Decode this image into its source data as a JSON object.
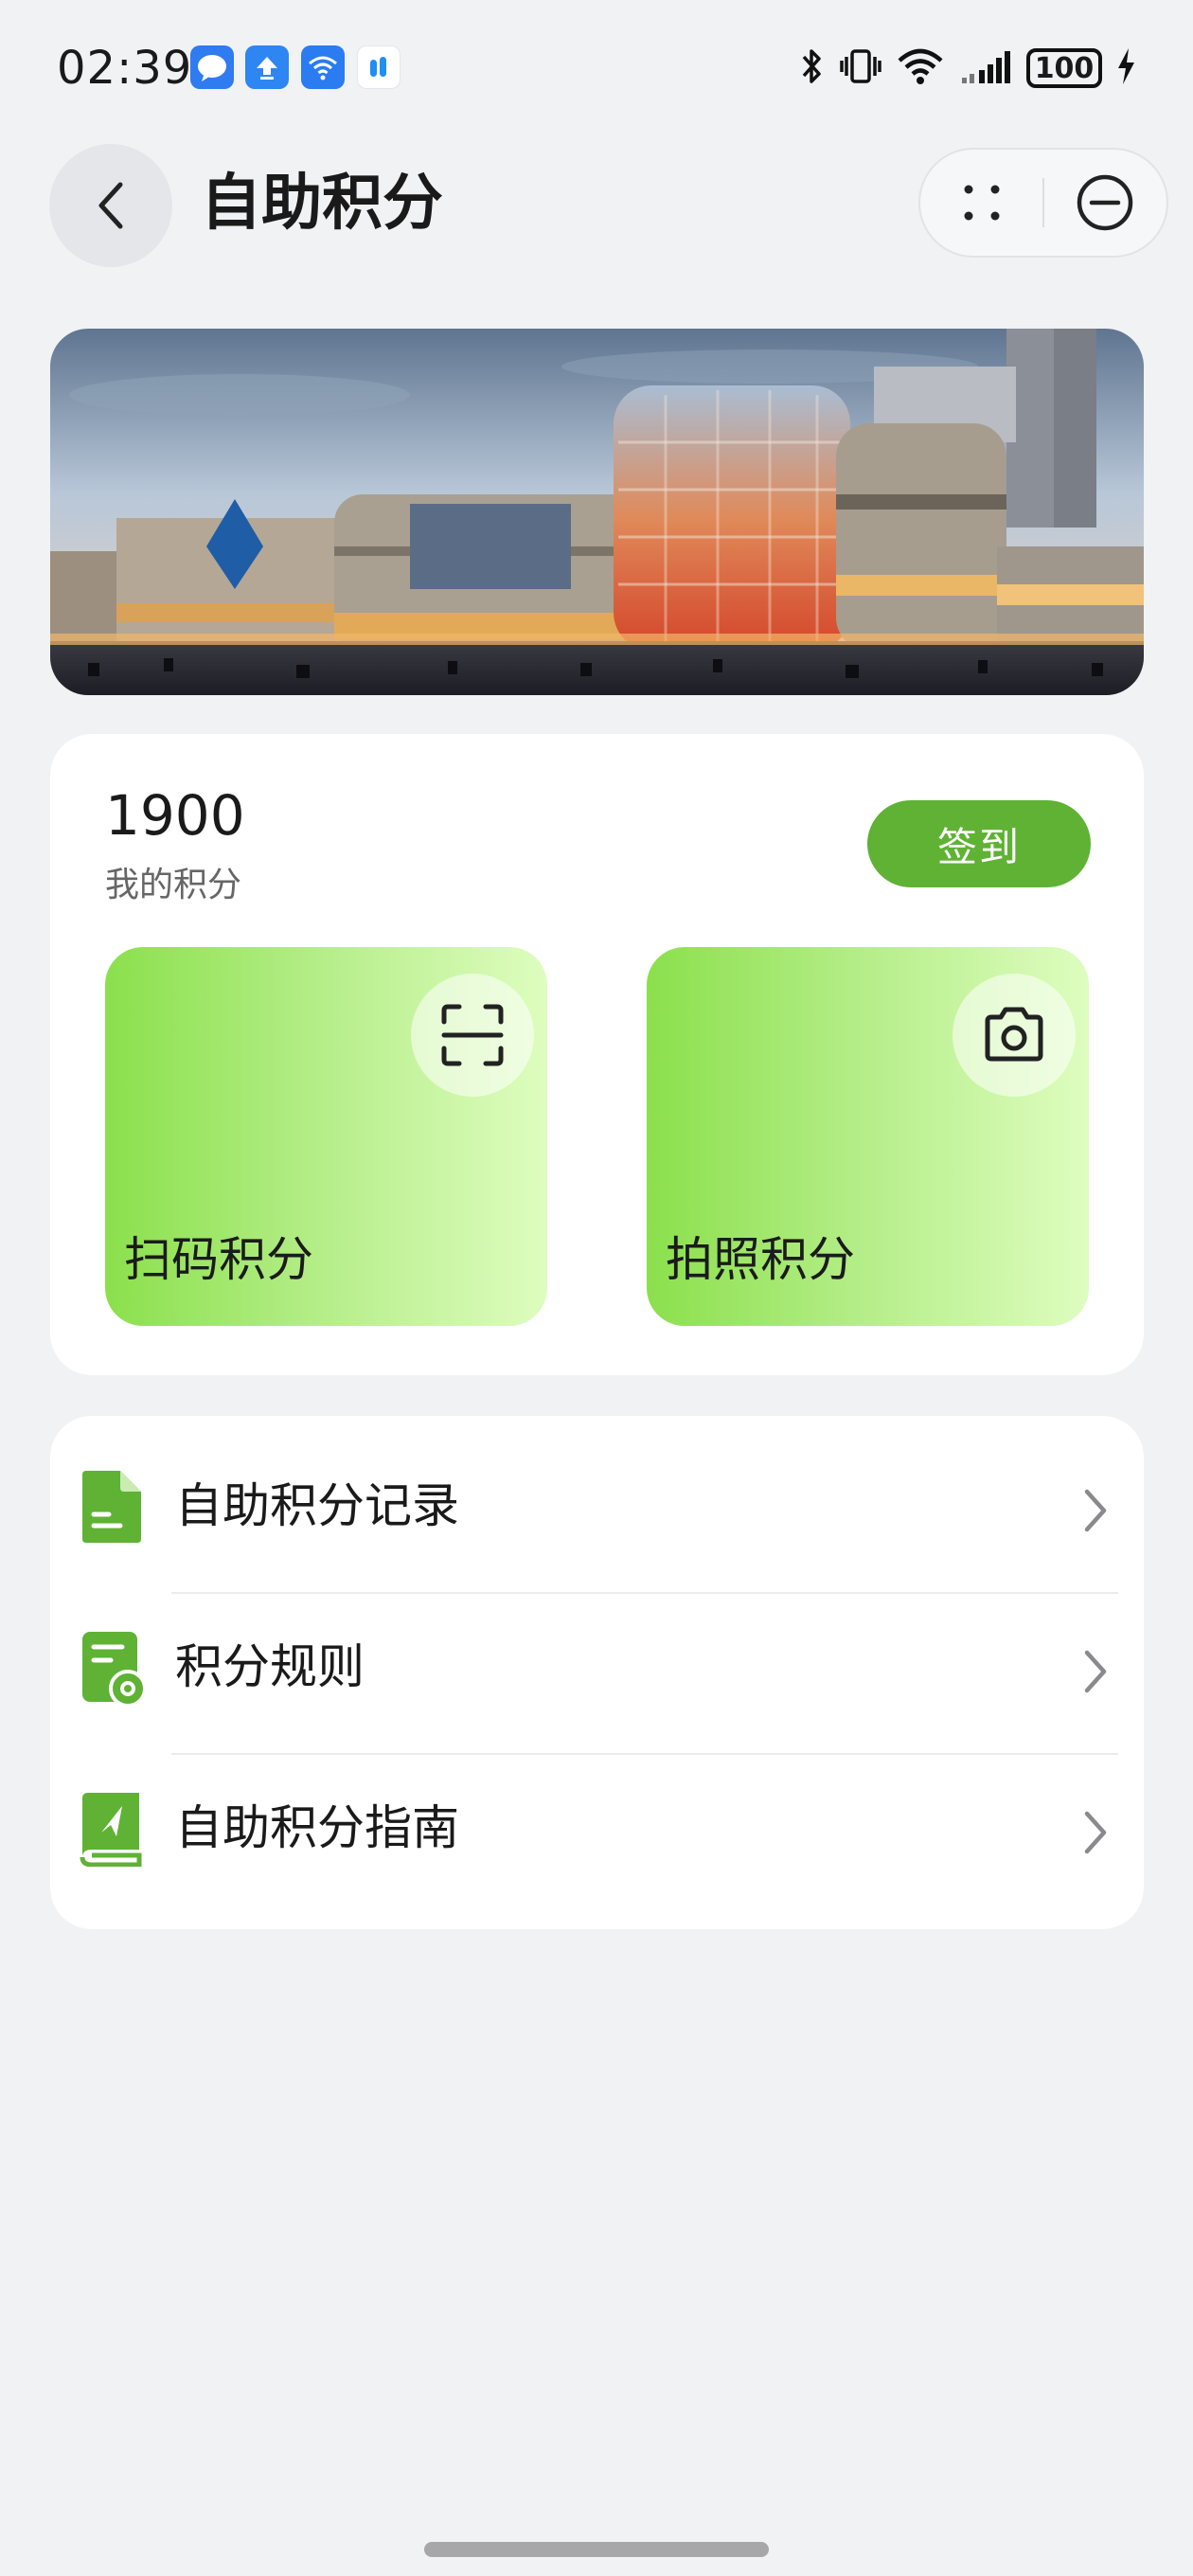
{
  "status_bar": {
    "time": "02:39",
    "notification_icons": [
      "message-icon",
      "upload-icon",
      "wifi-app-icon",
      "app-icon"
    ],
    "system_icons": [
      "bluetooth-icon",
      "vibrate-icon",
      "wifi-icon",
      "signal-icon",
      "battery-icon",
      "charging-icon"
    ],
    "battery": "100"
  },
  "header": {
    "title": "自助积分",
    "back_icon": "chevron-left-icon",
    "more_icon": "more-dots-icon",
    "close_icon": "minus-circle-icon"
  },
  "banner": {
    "subject": "shopping mall building"
  },
  "points": {
    "value": "1900",
    "label": "我的积分",
    "signin_label": "签到",
    "accent": "#5fb234",
    "tiles": [
      {
        "label": "扫码积分",
        "icon": "scan-icon"
      },
      {
        "label": "拍照积分",
        "icon": "camera-icon"
      }
    ]
  },
  "menu": {
    "items": [
      {
        "label": "自助积分记录",
        "icon": "document-icon"
      },
      {
        "label": "积分规则",
        "icon": "rules-icon"
      },
      {
        "label": "自助积分指南",
        "icon": "guide-book-icon"
      }
    ]
  }
}
